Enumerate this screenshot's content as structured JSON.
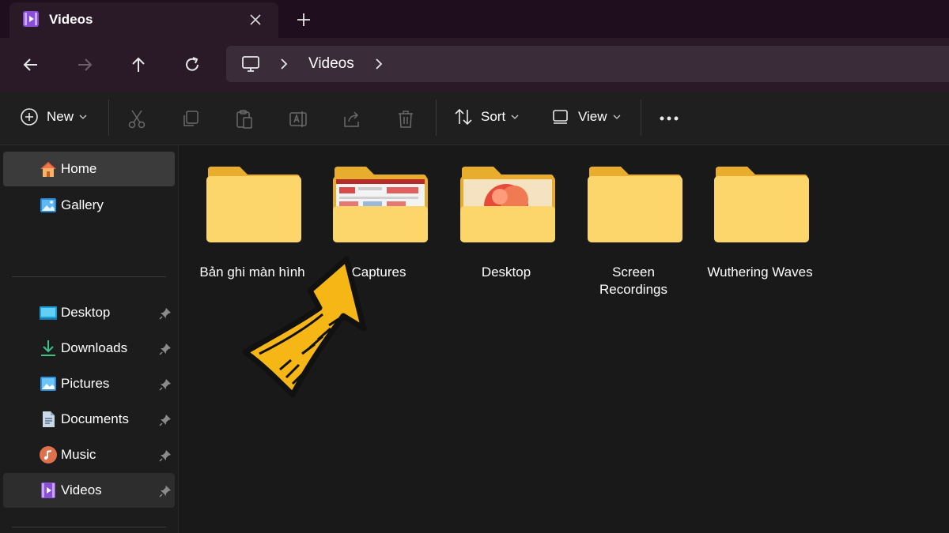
{
  "window": {
    "tab_title": "Videos",
    "tab_icon": "videos-folder-icon"
  },
  "address": {
    "breadcrumbs": [
      "Videos"
    ]
  },
  "toolbar": {
    "new_label": "New",
    "sort_label": "Sort",
    "view_label": "View"
  },
  "sidebar": {
    "top_items": [
      {
        "label": "Home",
        "icon": "home-icon"
      },
      {
        "label": "Gallery",
        "icon": "gallery-icon"
      }
    ],
    "pinned_items": [
      {
        "label": "Desktop",
        "icon": "desktop-icon"
      },
      {
        "label": "Downloads",
        "icon": "downloads-icon"
      },
      {
        "label": "Pictures",
        "icon": "pictures-icon"
      },
      {
        "label": "Documents",
        "icon": "documents-icon"
      },
      {
        "label": "Music",
        "icon": "music-icon"
      },
      {
        "label": "Videos",
        "icon": "videos-icon"
      }
    ]
  },
  "folders": [
    {
      "name": "Bản ghi màn hình"
    },
    {
      "name": "Captures"
    },
    {
      "name": "Desktop"
    },
    {
      "name": "Screen Recordings"
    },
    {
      "name": "Wuthering Waves"
    }
  ],
  "colors": {
    "titlebar": "#1f0e1d",
    "navbar": "#2a1a28",
    "folder_yellow": "#fcd66b",
    "arrow_yellow": "#f6b716"
  }
}
